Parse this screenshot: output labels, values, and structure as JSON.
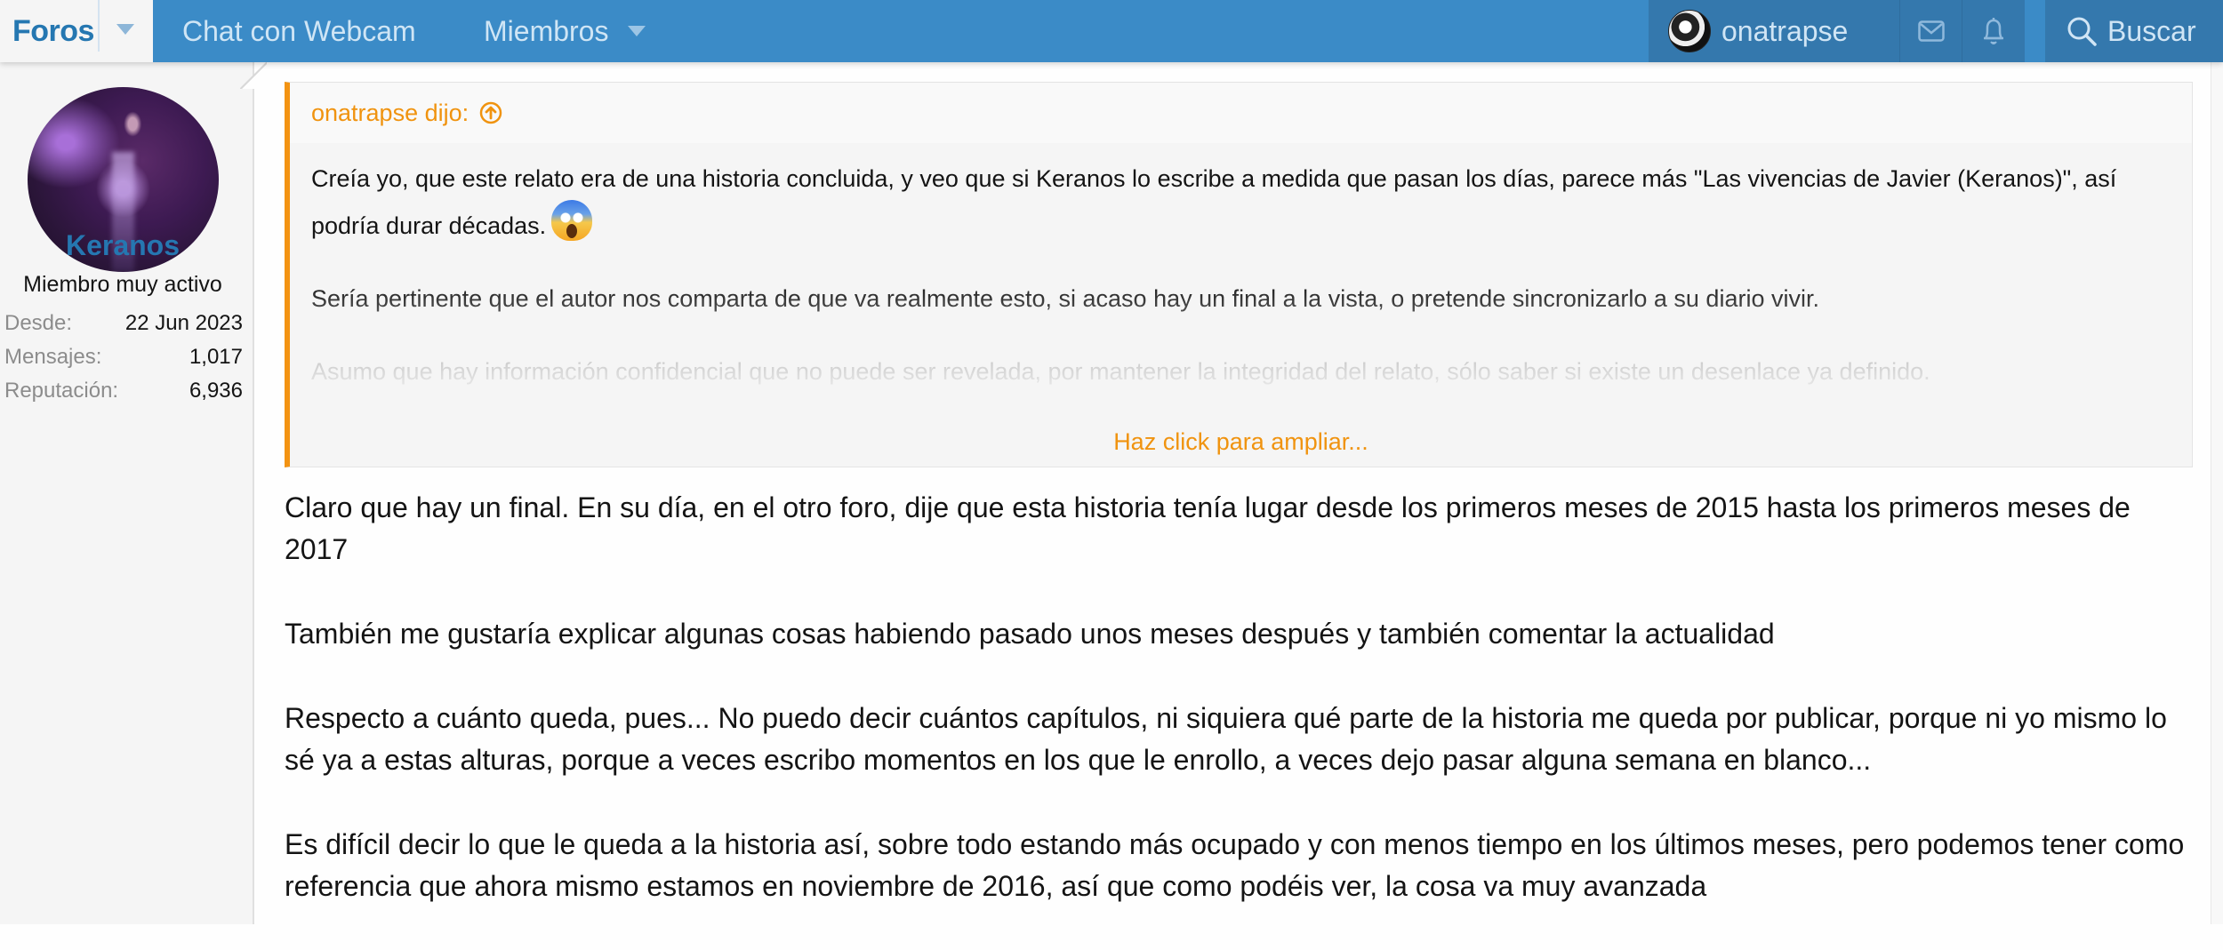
{
  "nav": {
    "home": "Foros",
    "tabs": [
      {
        "label": "Chat con Webcam",
        "has_dropdown": false
      },
      {
        "label": "Miembros",
        "has_dropdown": true
      }
    ],
    "user": "onatrapse",
    "icons": {
      "mail": "envelope-icon",
      "alerts": "bell-icon",
      "search": "magnifier-icon"
    },
    "search_label": "Buscar"
  },
  "author": {
    "name": "Keranos",
    "title": "Miembro muy activo",
    "stats": [
      {
        "label": "Desde:",
        "value": "22 Jun 2023"
      },
      {
        "label": "Mensajes:",
        "value": "1,017"
      },
      {
        "label": "Reputación:",
        "value": "6,936"
      }
    ]
  },
  "quote": {
    "attribution": "onatrapse dijo:",
    "paragraphs": [
      "Creía yo, que este relato era de una historia concluida, y veo que si Keranos lo escribe a medida que pasan los días, parece más \"Las vivencias de Javier (Keranos)\", así podría durar décadas.",
      "Sería pertinente que el autor nos comparta de que va realmente esto, si acaso hay un final a la vista, o pretende sincronizarlo a su diario vivir.",
      "Asumo que hay información confidencial que no puede ser revelada, por mantener la integridad del relato, sólo saber si existe un desenlace ya definido."
    ],
    "expand_label": "Haz click para ampliar..."
  },
  "post": {
    "paragraphs": [
      "Claro que hay un final. En su día, en el otro foro, dije que esta historia tenía lugar desde los primeros meses de 2015 hasta los primeros meses de 2017",
      "También me gustaría explicar algunas cosas habiendo pasado unos meses después y también comentar la actualidad",
      "Respecto a cuánto queda, pues... No puedo decir cuántos capítulos, ni siquiera qué parte de la historia me queda por publicar, porque ni yo mismo lo sé ya a estas alturas, porque a veces escribo momentos en los que le enrollo, a veces dejo pasar alguna semana en blanco...",
      "Es difícil decir lo que le queda a la historia así, sobre todo estando más ocupado y con menos tiempo en los últimos meses, pero podemos tener como referencia que ahora mismo estamos en noviembre de 2016, así que como podéis ver, la cosa va muy avanzada"
    ]
  },
  "colors": {
    "nav_bg": "#3b8bc7",
    "nav_dark": "#3478ad",
    "link_blue": "#2577b1",
    "quote_accent": "#f39312"
  }
}
